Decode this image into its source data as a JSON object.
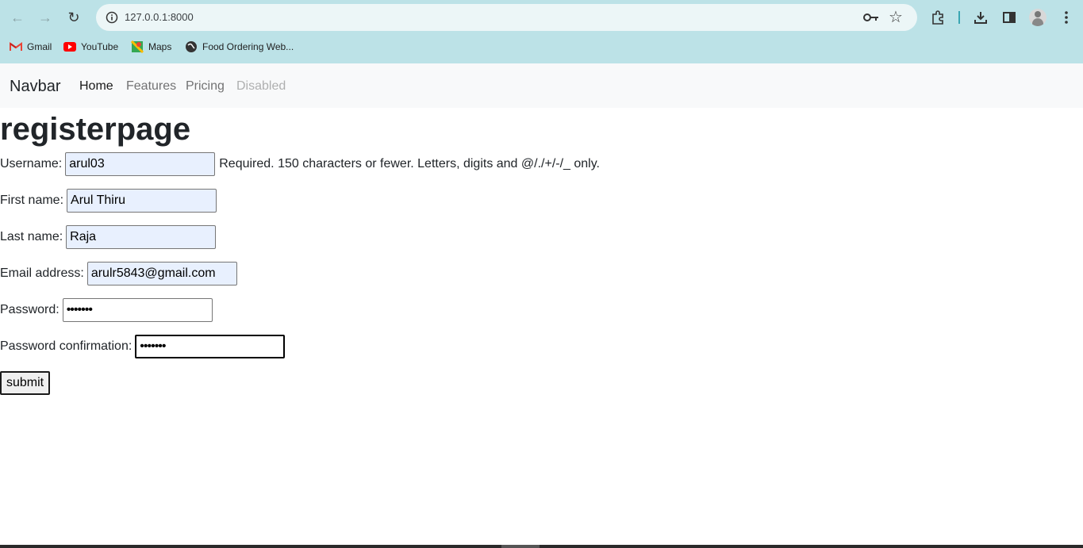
{
  "browser": {
    "url": "127.0.0.1:8000",
    "bookmarks": [
      {
        "label": "Gmail",
        "icon": "gmail-icon"
      },
      {
        "label": "YouTube",
        "icon": "youtube-icon"
      },
      {
        "label": "Maps",
        "icon": "maps-icon"
      },
      {
        "label": "Food Ordering Web...",
        "icon": "globe-icon"
      }
    ],
    "chrome_color": "#bce2e7"
  },
  "navbar": {
    "brand": "Navbar",
    "links": [
      "Home",
      "Features",
      "Pricing",
      "Disabled"
    ]
  },
  "page": {
    "title": "registerpage",
    "fields": {
      "username": {
        "label": "Username:",
        "value": "arul03",
        "help": "Required. 150 characters or fewer. Letters, digits and @/./+/-/_ only."
      },
      "first_name": {
        "label": "First name:",
        "value": "Arul Thiru"
      },
      "last_name": {
        "label": "Last name:",
        "value": "Raja"
      },
      "email": {
        "label": "Email address:",
        "value": "arulr5843@gmail.com"
      },
      "password": {
        "label": "Password:",
        "value": "•••••••"
      },
      "password_confirmation": {
        "label": "Password confirmation:",
        "value": "•••••••"
      }
    },
    "submit_label": "submit"
  }
}
